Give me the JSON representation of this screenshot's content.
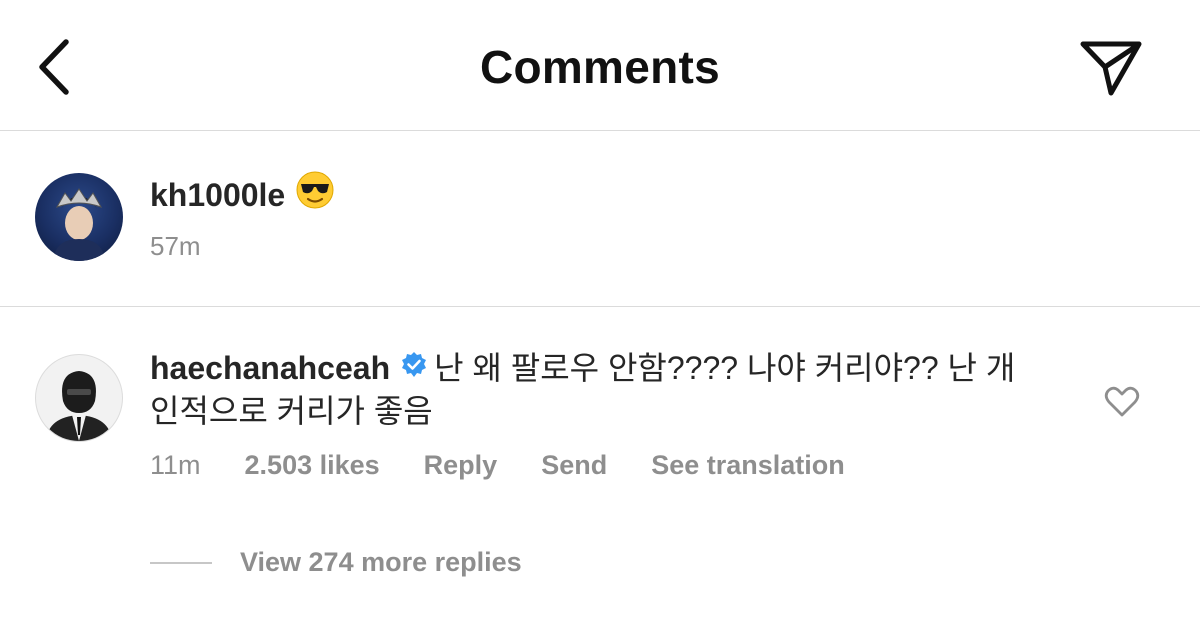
{
  "header": {
    "title": "Comments",
    "back_icon": "chevron-left-icon",
    "share_icon": "paper-plane-icon"
  },
  "caption": {
    "username": "kh1000le",
    "emoji": "sunglasses-face-icon",
    "time": "57m"
  },
  "comment": {
    "username": "haechanahceah",
    "verified_icon": "verified-badge-icon",
    "verified_color": "#3897f0",
    "text": "난 왜 팔로우 안함???? 나야 커리야?? 난 개 인적으로 커리가 좋음",
    "time": "11m",
    "likes": "2.503 likes",
    "reply_label": "Reply",
    "send_label": "Send",
    "translate_label": "See translation",
    "like_icon": "heart-outline-icon"
  },
  "replies": {
    "label": "View 274 more replies"
  },
  "colors": {
    "text_primary": "#262626",
    "text_secondary": "#8e8e8e",
    "divider": "#dbdbdb"
  }
}
